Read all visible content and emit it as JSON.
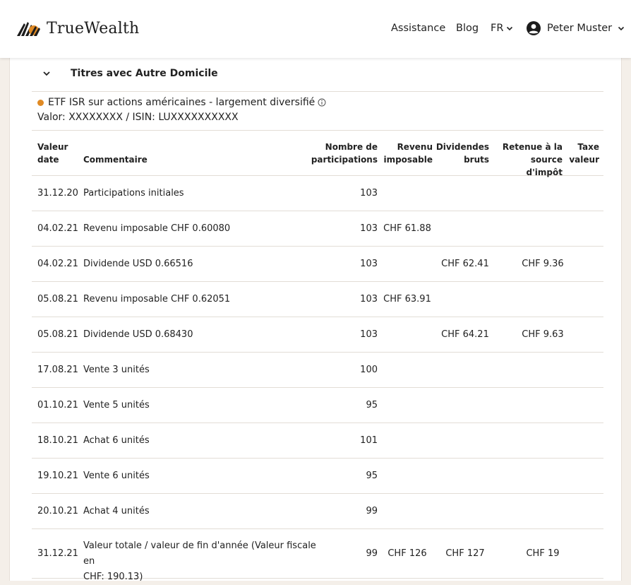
{
  "header": {
    "brand": "TrueWealth",
    "nav": {
      "assistance": "Assistance",
      "blog": "Blog",
      "language": "FR",
      "user": "Peter Muster"
    }
  },
  "section": {
    "title": "Titres avec Autre Domicile"
  },
  "security": {
    "name": "ETF ISR sur actions américaines - largement diversifié",
    "ids": "Valor: XXXXXXXX / ISIN: LUXXXXXXXXXX",
    "dot_color": "#e08a24"
  },
  "table": {
    "columns": {
      "date_1": "Valeur",
      "date_2": "date",
      "comment": "Commentaire",
      "nb_1": "Nombre de",
      "nb_2": "participations",
      "rev_1": "Revenu",
      "rev_2": "imposable",
      "div_1": "Dividendes",
      "div_2": "bruts",
      "ret_1": "Retenue à la",
      "ret_2": "source d'impôt",
      "tax_1": "Taxe",
      "tax_2": "valeur"
    },
    "rows": [
      {
        "date": "31.12.20",
        "comment": "Participations initiales",
        "nb": "103",
        "rev": "",
        "div": "",
        "ret": "",
        "tax": ""
      },
      {
        "date": "04.02.21",
        "comment": "Revenu imposable CHF 0.60080",
        "nb": "103",
        "rev": "CHF 61.88",
        "div": "",
        "ret": "",
        "tax": ""
      },
      {
        "date": "04.02.21",
        "comment": "Dividende USD 0.66516",
        "nb": "103",
        "rev": "",
        "div": "CHF 62.41",
        "ret": "CHF 9.36",
        "tax": ""
      },
      {
        "date": "05.08.21",
        "comment": "Revenu imposable CHF 0.62051",
        "nb": "103",
        "rev": "CHF 63.91",
        "div": "",
        "ret": "",
        "tax": ""
      },
      {
        "date": "05.08.21",
        "comment": "Dividende USD 0.68430",
        "nb": "103",
        "rev": "",
        "div": "CHF 64.21",
        "ret": "CHF 9.63",
        "tax": ""
      },
      {
        "date": "17.08.21",
        "comment": "Vente 3 unités",
        "nb": "100",
        "rev": "",
        "div": "",
        "ret": "",
        "tax": ""
      },
      {
        "date": "01.10.21",
        "comment": "Vente 5 unités",
        "nb": "95",
        "rev": "",
        "div": "",
        "ret": "",
        "tax": ""
      },
      {
        "date": "18.10.21",
        "comment": "Achat 6 unités",
        "nb": "101",
        "rev": "",
        "div": "",
        "ret": "",
        "tax": ""
      },
      {
        "date": "19.10.21",
        "comment": "Vente 6 unités",
        "nb": "95",
        "rev": "",
        "div": "",
        "ret": "",
        "tax": ""
      },
      {
        "date": "20.10.21",
        "comment": "Achat 4 unités",
        "nb": "99",
        "rev": "",
        "div": "",
        "ret": "",
        "tax": ""
      }
    ],
    "total": {
      "date": "31.12.21",
      "comment_1": "Valeur totale / valeur de fin d'année (Valeur fiscale en",
      "comment_2": "CHF: 190.13)",
      "nb": "99",
      "rev": "CHF 126",
      "div": "CHF 127",
      "ret": "CHF 19",
      "tax": ""
    }
  }
}
